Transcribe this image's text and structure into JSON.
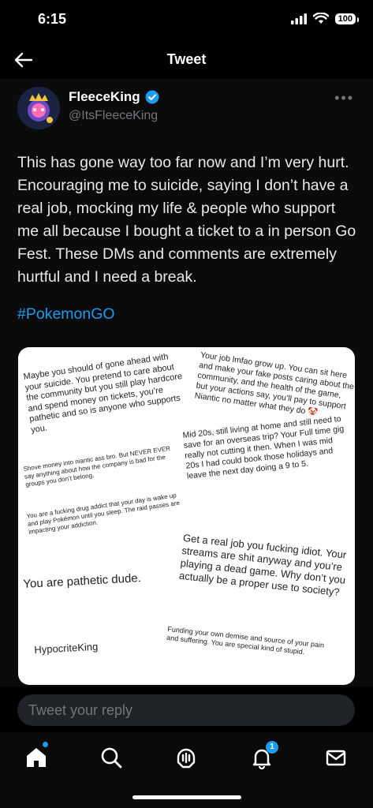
{
  "status_bar": {
    "time": "6:15",
    "battery": "100"
  },
  "header": {
    "title": "Tweet"
  },
  "tweet": {
    "author_name": "FleeceKing",
    "author_handle": "@ItsFleeceKing",
    "verified": true,
    "text": "This has gone way too far now and I’m very hurt. Encouraging me to suicide, saying I don’t have a real job, mocking my life & people who support me all because I bought a ticket to a in person Go Fest. These DMs and comments are extremely hurtful and I need a break.",
    "hashtag": "#PokemonGO"
  },
  "image_notes": {
    "n1": "Maybe you should of gone ahead with your suicide. You pretend to care about the community but you still play hardcore and spend money on tickets, you’re pathetic and so is anyone who supports you.",
    "n2": "Your job lmfao grow up. You can sit here and make your fake posts caring about the community, and the health of the game, but your actions say, you’ll pay to support Niantic no matter what they do 🤡",
    "n3": "Shove money into niantic ass bro. But NEVER EVER say anything about how the company is bad for the groups you don’t belong.",
    "n4": "Mid 20s, still living at home and still need to save for an overseas trip? Your Full time gig really not cutting it then. When I was mid 20s I had could book those holidays and leave the next day doing a 9 to 5.",
    "n5": "You are a fucking drug addict that your day is wake up and play Pokémon until you sleep. The raid passes are impacting your addiction.",
    "n6": "You are pathetic dude.",
    "n7": "Get a real job you fucking idiot. Your streams are shit anyway and you’re playing a dead game. Why don’t you actually be a proper use to society?",
    "n8": "Funding your own demise and source of your pain and suffering. You are special kind of stupid.",
    "n9": "HypocriteKing"
  },
  "reply": {
    "placeholder": "Tweet your reply"
  },
  "tabbar": {
    "notifications_count": "1"
  },
  "colors": {
    "accent": "#1d9bf0",
    "background": "#000000",
    "muted": "#71767b"
  }
}
